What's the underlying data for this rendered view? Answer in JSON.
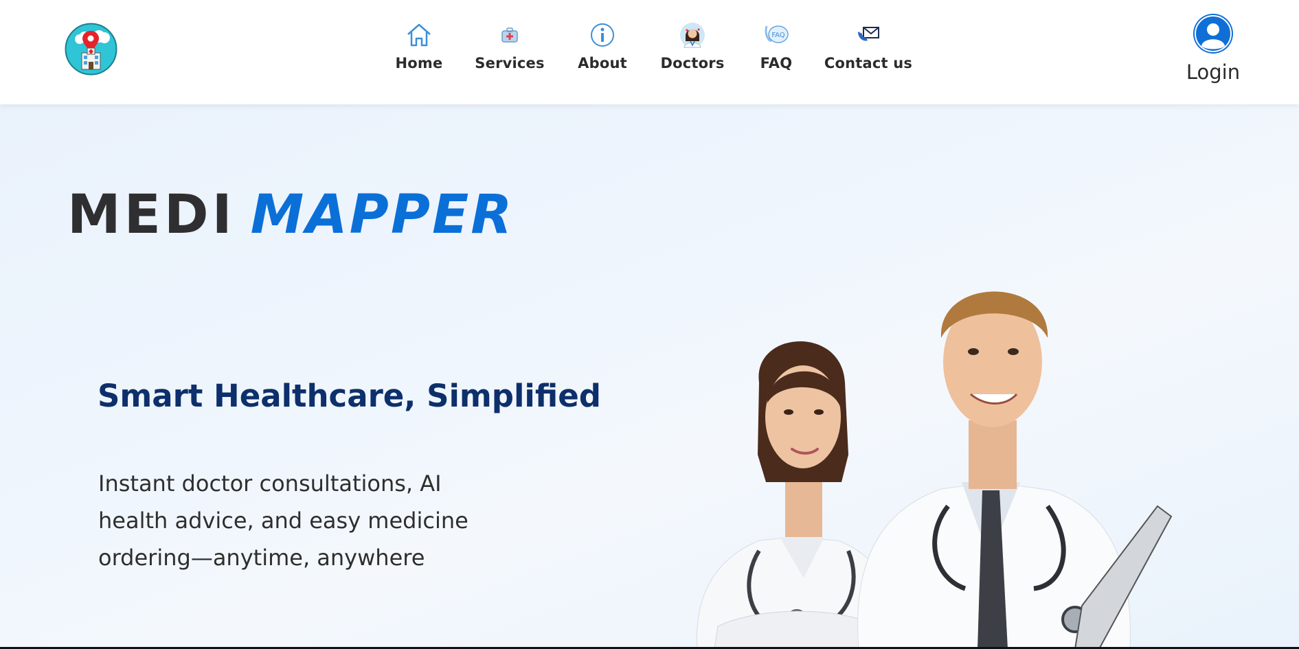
{
  "header": {
    "logo_icon": "hospital-location-logo-icon",
    "nav": [
      {
        "label": "Home",
        "icon": "home-icon"
      },
      {
        "label": "Services",
        "icon": "medical-kit-icon"
      },
      {
        "label": "About",
        "icon": "info-icon"
      },
      {
        "label": "Doctors",
        "icon": "doctor-avatar-icon"
      },
      {
        "label": "FAQ",
        "icon": "faq-bubble-icon"
      },
      {
        "label": "Contact us",
        "icon": "envelope-phone-icon"
      }
    ],
    "login": {
      "label": "Login",
      "icon": "user-avatar-icon"
    }
  },
  "hero": {
    "brand_word1": "MEDI",
    "brand_word2": "MAPPER",
    "tagline": "Smart Healthcare, Simplified",
    "description": "Instant doctor consultations, AI health advice, and easy medicine ordering—anytime, anywhere",
    "image": "doctors-photo"
  },
  "colors": {
    "brand_dark": "#2f2f31",
    "brand_blue": "#0b6fd8",
    "tagline_navy": "#0d2f6b",
    "hero_bg": "#eef5fd",
    "login_blue": "#0f6fd6"
  }
}
